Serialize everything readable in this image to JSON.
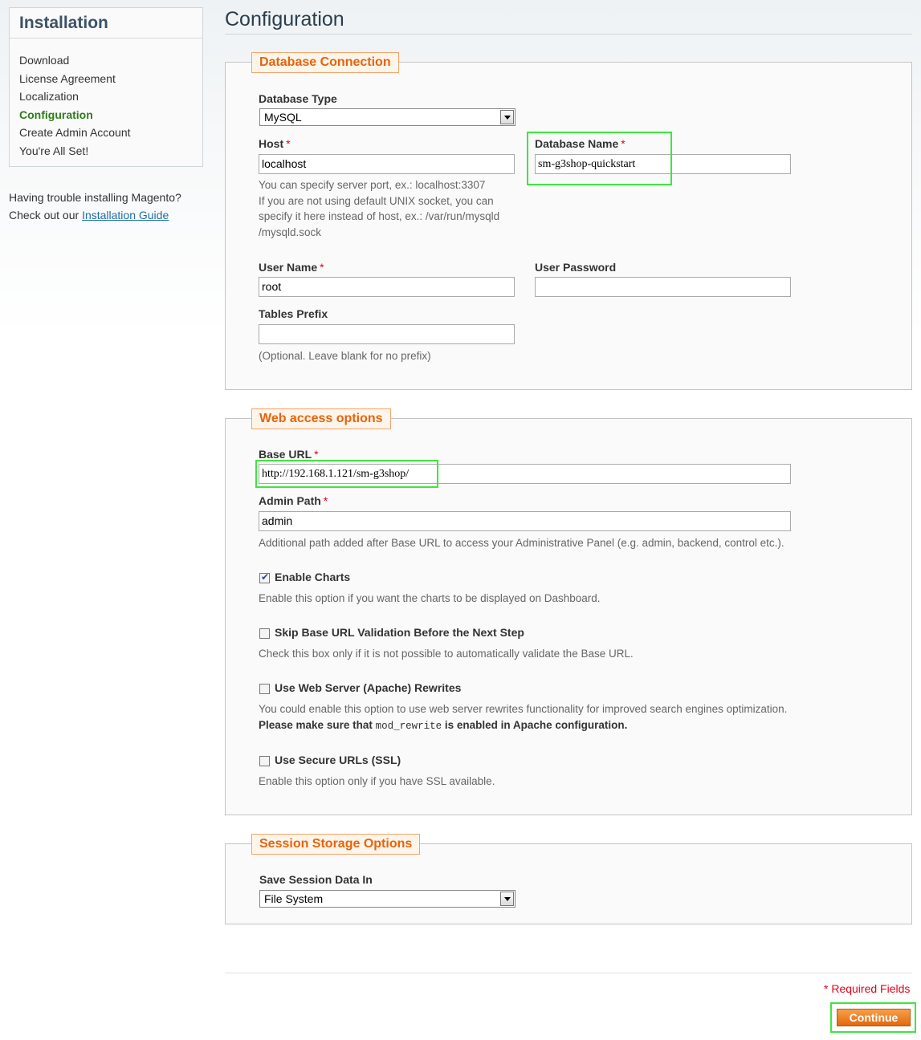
{
  "sidebar": {
    "title": "Installation",
    "items": [
      {
        "label": "Download"
      },
      {
        "label": "License Agreement"
      },
      {
        "label": "Localization"
      },
      {
        "label": "Configuration",
        "active": true
      },
      {
        "label": "Create Admin Account"
      },
      {
        "label": "You're All Set!"
      }
    ],
    "help_text": "Having trouble installing Magento?",
    "help_prefix": "Check out our",
    "help_link": "Installation Guide"
  },
  "page_title": "Configuration",
  "db": {
    "legend": "Database Connection",
    "type_label": "Database Type",
    "type_value": "MySQL",
    "host_label": "Host",
    "host_value": "localhost",
    "host_note_1": "You can specify server port, ex.: localhost:3307",
    "host_note_2": "If you are not using default UNIX socket, you can",
    "host_note_3": "specify it here instead of host, ex.: /var/run/mysqld",
    "host_note_4": "/mysqld.sock",
    "name_label": "Database Name",
    "name_value": "sm-g3shop-quickstart",
    "user_label": "User Name",
    "user_value": "root",
    "pass_label": "User Password",
    "pass_value": "",
    "prefix_label": "Tables Prefix",
    "prefix_value": "",
    "prefix_note": "(Optional. Leave blank for no prefix)"
  },
  "web": {
    "legend": "Web access options",
    "base_url_label": "Base URL",
    "base_url_value": "http://192.168.1.121/sm-g3shop/",
    "admin_path_label": "Admin Path",
    "admin_path_value": "admin",
    "admin_path_note": "Additional path added after Base URL to access your Administrative Panel (e.g. admin, backend, control etc.).",
    "enable_charts_label": "Enable Charts",
    "enable_charts_checked": true,
    "enable_charts_note": "Enable this option if you want the charts to be displayed on Dashboard.",
    "skip_validation_label": "Skip Base URL Validation Before the Next Step",
    "skip_validation_checked": false,
    "skip_validation_note": "Check this box only if it is not possible to automatically validate the Base URL.",
    "rewrites_label": "Use Web Server (Apache) Rewrites",
    "rewrites_checked": false,
    "rewrites_note_1": "You could enable this option to use web server rewrites functionality for improved search engines optimization.",
    "rewrites_note_2a": "Please make sure that",
    "rewrites_note_2b": "mod_rewrite",
    "rewrites_note_2c": "is enabled in Apache configuration.",
    "ssl_label": "Use Secure URLs (SSL)",
    "ssl_checked": false,
    "ssl_note": "Enable this option only if you have SSL available."
  },
  "session": {
    "legend": "Session Storage Options",
    "save_label": "Save Session Data In",
    "save_value": "File System"
  },
  "required_marker": "*",
  "required_fields": "* Required Fields",
  "continue_label": "Continue",
  "colors": {
    "accent_orange": "#e8630c",
    "active_green": "#2d7d1b",
    "highlight_green": "#3ee63e",
    "required_red": "#e3001b"
  }
}
